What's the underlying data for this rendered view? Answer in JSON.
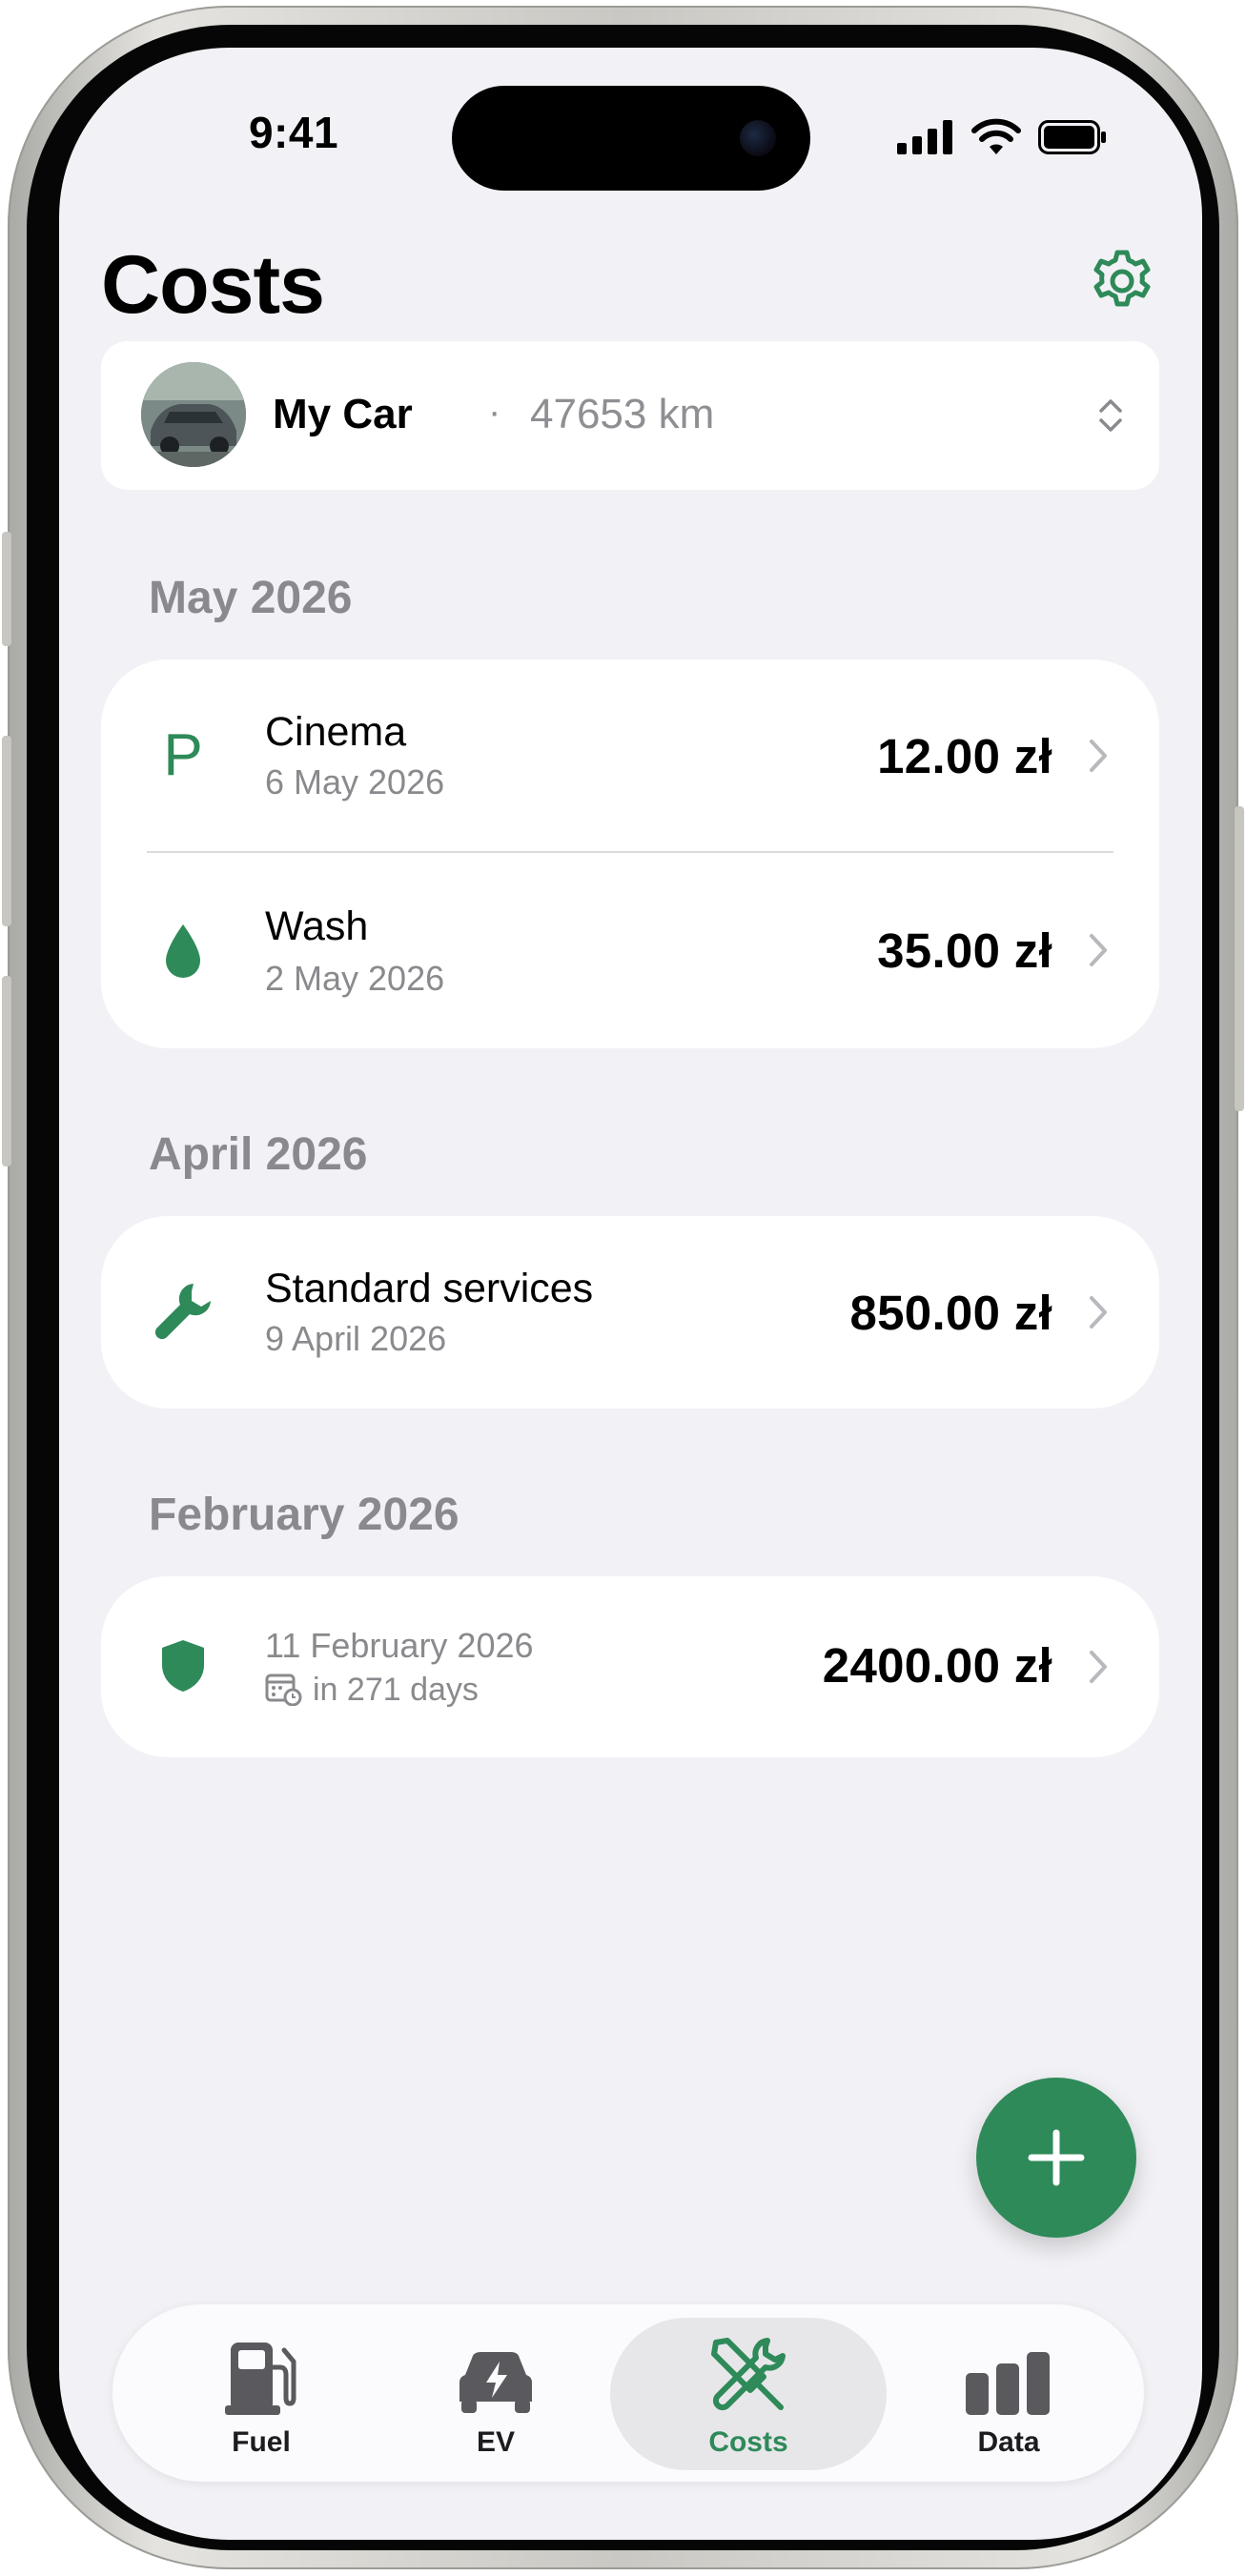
{
  "status_bar": {
    "time": "9:41"
  },
  "header": {
    "title": "Costs"
  },
  "car": {
    "name": "My Car",
    "separator": "·",
    "mileage": "47653 km"
  },
  "sections": [
    {
      "month": "May 2026",
      "items": [
        {
          "icon": "parking-icon",
          "icon_glyph": "P",
          "name": "Cinema",
          "date": "6 May 2026",
          "amount": "12.00 zł"
        },
        {
          "icon": "water-drop-icon",
          "name": "Wash",
          "date": "2 May 2026",
          "amount": "35.00 zł"
        }
      ]
    },
    {
      "month": "April 2026",
      "items": [
        {
          "icon": "wrench-icon",
          "name": "Standard services",
          "date": "9 April 2026",
          "amount": "850.00 zł"
        }
      ]
    },
    {
      "month": "February 2026",
      "items": [
        {
          "icon": "shield-icon",
          "date": "11 February 2026",
          "reminder": "in 271 days",
          "amount": "2400.00 zł"
        }
      ]
    }
  ],
  "tabbar": {
    "tabs": [
      {
        "label": "Fuel",
        "icon": "fuel-pump-icon"
      },
      {
        "label": "EV",
        "icon": "ev-car-icon"
      },
      {
        "label": "Costs",
        "icon": "tools-icon",
        "active": true
      },
      {
        "label": "Data",
        "icon": "bar-chart-icon"
      }
    ]
  },
  "colors": {
    "accent": "#2e8a58",
    "background": "#f2f2f6",
    "secondary_text": "#8a8a8e"
  }
}
